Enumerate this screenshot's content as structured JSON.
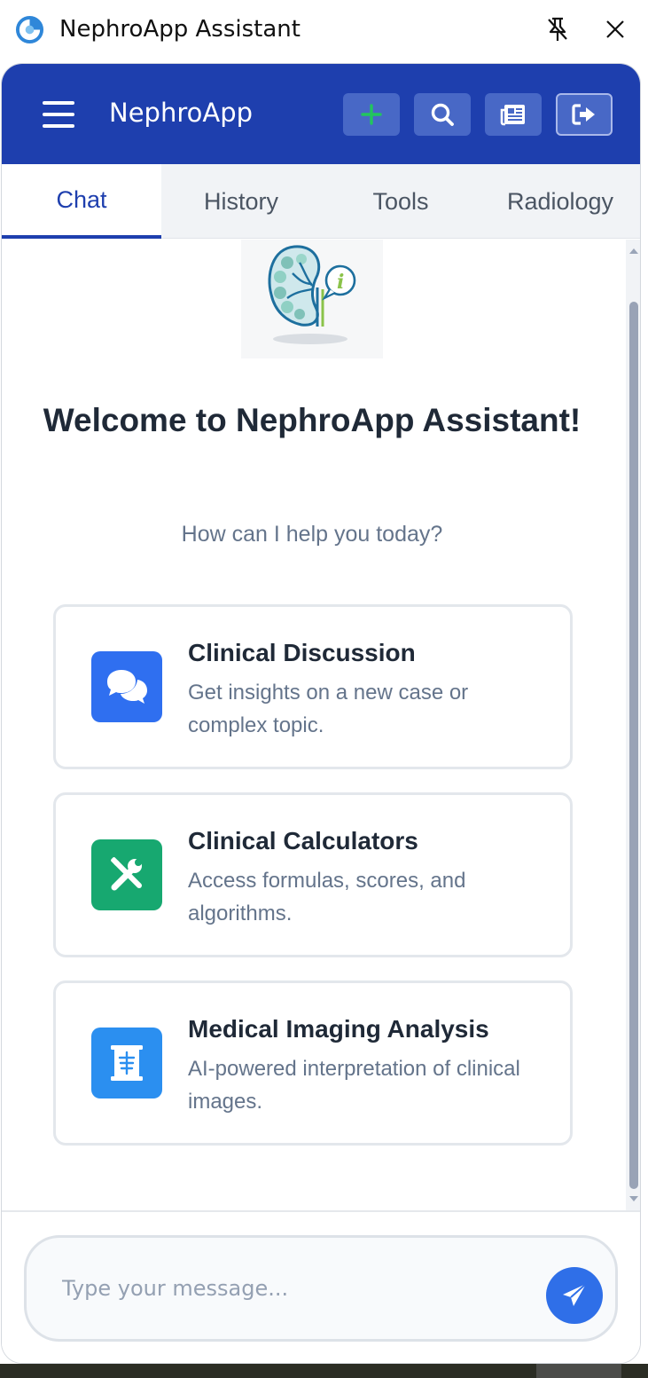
{
  "window": {
    "title": "NephroApp Assistant",
    "icons": {
      "app": "app-logo-icon",
      "pin": "unpin-icon",
      "close": "close-icon"
    }
  },
  "header": {
    "brand": "NephroApp",
    "icons": {
      "menu": "hamburger-menu-icon",
      "new": "plus-icon",
      "search": "search-icon",
      "news": "newspaper-icon",
      "logout": "sign-out-icon"
    },
    "colors": {
      "background": "#1e3fae",
      "plus": "#22c55e"
    }
  },
  "tabs": [
    {
      "label": "Chat",
      "active": true
    },
    {
      "label": "History",
      "active": false
    },
    {
      "label": "Tools",
      "active": false
    },
    {
      "label": "Radiology",
      "active": false
    }
  ],
  "welcome": {
    "title": "Welcome to NephroApp Assistant!",
    "subtitle": "How can I help you today?"
  },
  "cards": [
    {
      "title": "Clinical Discussion",
      "description": "Get insights on a new case or complex topic.",
      "icon": "chat-bubbles-icon",
      "color": "#2f6ff0"
    },
    {
      "title": "Clinical Calculators",
      "description": "Access formulas, scores, and algorithms.",
      "icon": "tools-icon",
      "color": "#17a870"
    },
    {
      "title": "Medical Imaging Analysis",
      "description": "AI-powered interpretation of clinical images.",
      "icon": "x-ray-icon",
      "color": "#2b8ff0"
    }
  ],
  "composer": {
    "placeholder": "Type your message...",
    "send_icon": "paper-plane-icon"
  }
}
